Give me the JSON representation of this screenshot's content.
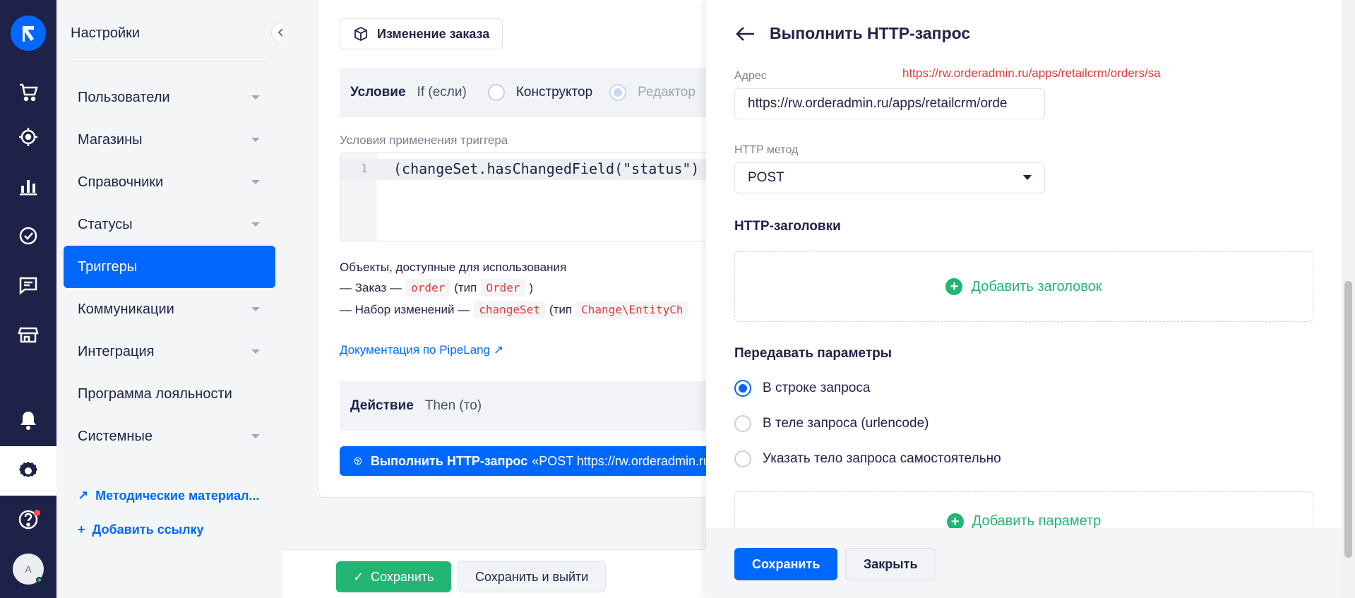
{
  "sidebar": {
    "title": "Настройки",
    "items": [
      {
        "label": "Пользователи"
      },
      {
        "label": "Магазины"
      },
      {
        "label": "Справочники"
      },
      {
        "label": "Статусы"
      },
      {
        "label": "Триггеры"
      },
      {
        "label": "Коммуникации"
      },
      {
        "label": "Интеграция"
      },
      {
        "label": "Программа лояльности"
      },
      {
        "label": "Системные"
      }
    ],
    "links": {
      "methodical": "Методические материал...",
      "add_link": "Добавить ссылку"
    }
  },
  "rail": {
    "avatar_letter": "А"
  },
  "main": {
    "order_change_button": "Изменение заказа",
    "condition": {
      "title": "Условие",
      "subtitle": "If (если)",
      "constructor": "Конструктор",
      "editor": "Редактор"
    },
    "trigger_conditions_label": "Условия применения триггера",
    "code": {
      "line": "1",
      "text": "(changeSet.hasChangedField(\"status\")"
    },
    "objects_title": "Объекты, доступные для использования",
    "obj1": {
      "prefix": "— Заказ —",
      "var": "order",
      "type_prefix": "(тип",
      "type": "Order",
      "suffix": ")"
    },
    "obj2": {
      "prefix": "— Набор изменений —",
      "var": "changeSet",
      "type_prefix": "(тип",
      "type": "Change\\EntityCh"
    },
    "doc_link": "Документация по PipeLang",
    "action": {
      "title": "Действие",
      "subtitle": "Then (то)"
    },
    "action_item": {
      "bold": "Выполнить HTTP-запрос",
      "rest": "«POST https://rw.orderadmin.ru/a"
    },
    "footer": {
      "save": "Сохранить",
      "save_exit": "Сохранить и выйти"
    }
  },
  "panel": {
    "title": "Выполнить HTTP-запрос",
    "address_label": "Адрес",
    "address_value": "https://rw.orderadmin.ru/apps/retailcrm/orde",
    "red_url": "https://rw.orderadmin.ru/apps/retailcrm/orders/sa",
    "method_label": "HTTP метод",
    "method_value": "POST",
    "headers_title": "HTTP-заголовки",
    "add_header": "Добавить заголовок",
    "params_title": "Передавать параметры",
    "options": [
      "В строке запроса",
      "В теле запроса (urlencode)",
      "Указать тело запроса самостоятельно"
    ],
    "add_param": "Добавить параметр",
    "save": "Сохранить",
    "close": "Закрыть"
  },
  "colors": {
    "accent": "#0068ff",
    "rail": "#1e2248",
    "green": "#22b573",
    "code_red": "#e33b3b"
  }
}
